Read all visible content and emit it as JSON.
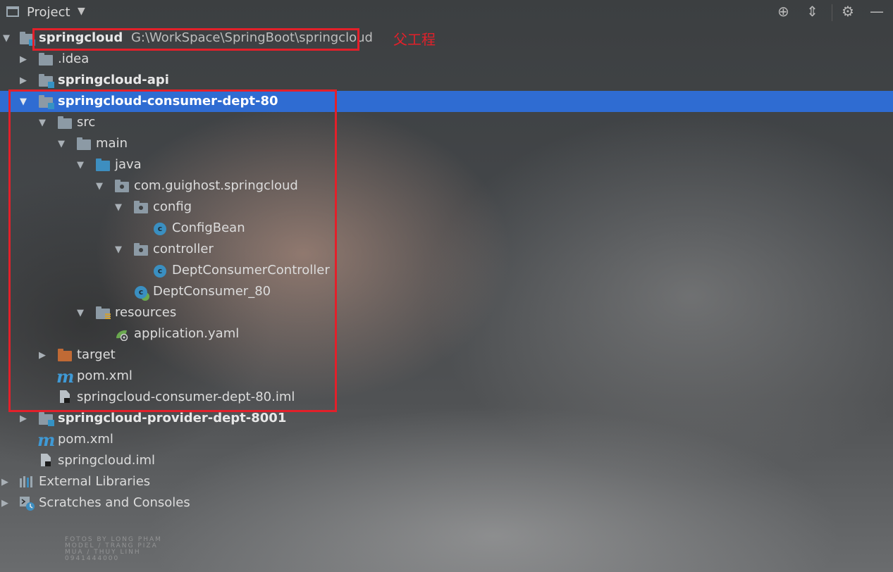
{
  "toolbar": {
    "title": "Project",
    "icons": [
      "locate-icon",
      "collapse-all-icon",
      "gear-icon",
      "minimize-icon"
    ]
  },
  "tree": {
    "root": {
      "name": "springcloud",
      "path": "G:\\WorkSpace\\SpringBoot\\springcloud"
    },
    "idea": ".idea",
    "api": "springcloud-api",
    "consumer": "springcloud-consumer-dept-80",
    "src": "src",
    "main": "main",
    "java": "java",
    "package": "com.guighost.springcloud",
    "config": "config",
    "config_bean": "ConfigBean",
    "controller": "controller",
    "dept_consumer_controller": "DeptConsumerController",
    "dept_consumer_main": "DeptConsumer_80",
    "resources": "resources",
    "app_yaml": "application.yaml",
    "target": "target",
    "consumer_pom": "pom.xml",
    "consumer_iml": "springcloud-consumer-dept-80.iml",
    "provider": "springcloud-provider-dept-8001",
    "root_pom": "pom.xml",
    "root_iml": "springcloud.iml",
    "external_libraries": "External Libraries",
    "scratches": "Scratches and Consoles"
  },
  "annotation": "父工程",
  "watermark": {
    "line1": "FOTOS BY LONG PHAM",
    "line2": "MODEL / TRANG PIZA",
    "line3": "MUA / THUY LINH",
    "line4": "0941444000"
  },
  "colors": {
    "selection": "#2f6cd2",
    "annotation_red": "#e3202a"
  }
}
